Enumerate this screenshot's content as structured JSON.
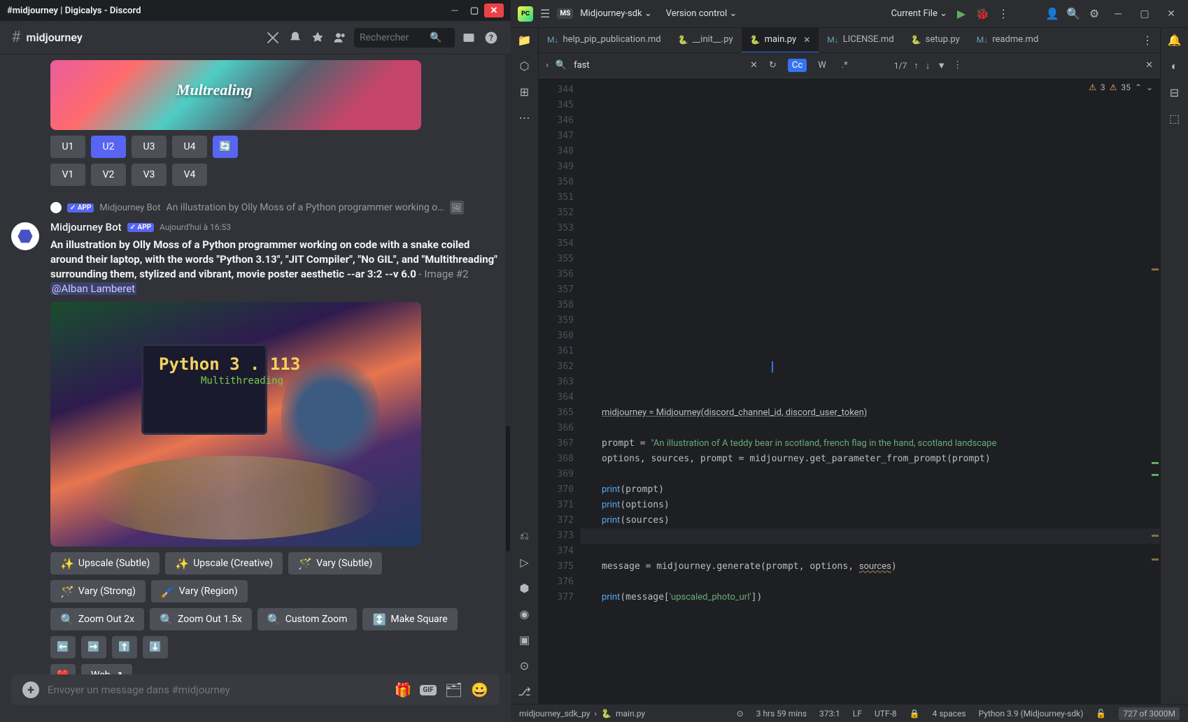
{
  "discord": {
    "window_title": "#midjourney | Digicalys - Discord",
    "channel_name": "midjourney",
    "search_placeholder": "Rechercher",
    "thumb_overlay_text": "Multrealing",
    "u_buttons": [
      "U1",
      "U2",
      "U3",
      "U4"
    ],
    "v_buttons": [
      "V1",
      "V2",
      "V3",
      "V4"
    ],
    "reply_channel": "#midjourney",
    "reply_bot": "Midjourney Bot",
    "reply_tag": "✓ APP",
    "reply_preview": "An illustration by Olly Moss of a Python programmer working o…",
    "bot_name": "Midjourney Bot",
    "bot_tag": "✓ APP",
    "timestamp": "Aujourd'hui à 16:53",
    "prompt_bold": "An illustration by Olly Moss of a Python programmer working on code with a snake coiled around their laptop, with the words \"Python 3.13\", \"JIT Compiler\", \"No GIL\", and \"Multithreading\" surrounding them, stylized and vibrant, movie poster aesthetic --ar 3:2 --v 6.0",
    "image_num": " - Image #2 ",
    "mention": "@Alban Lamberet",
    "gen_img_text1": "Python  3 . 113",
    "gen_img_text2": "Multithreading",
    "action_row1": [
      {
        "icon": "✨",
        "label": "Upscale (Subtle)"
      },
      {
        "icon": "✨",
        "label": "Upscale (Creative)"
      },
      {
        "icon": "🪄",
        "label": "Vary (Subtle)"
      }
    ],
    "action_row2": [
      {
        "icon": "🪄",
        "label": "Vary (Strong)"
      },
      {
        "icon": "🖌️",
        "label": "Vary (Region)"
      }
    ],
    "action_row3": [
      {
        "icon": "🔍",
        "label": "Zoom Out 2x"
      },
      {
        "icon": "🔍",
        "label": "Zoom Out 1.5x"
      },
      {
        "icon": "🔍",
        "label": "Custom Zoom"
      },
      {
        "icon": "↕️",
        "label": "Make Square"
      }
    ],
    "arrow_row": [
      "⬅️",
      "➡️",
      "⬆️",
      "⬇️"
    ],
    "extra_row": [
      {
        "icon": "❤️",
        "label": ""
      },
      {
        "icon": "",
        "label": "Web",
        "trail": "↗"
      }
    ],
    "input_placeholder": "Envoyer un message dans #midjourney",
    "gif_label": "GIF"
  },
  "ide": {
    "project_badge": "MS",
    "project_name": "Midjourney-sdk",
    "version_control": "Version control",
    "run_config": "Current File",
    "tabs": [
      {
        "icon": "M↓",
        "label": "help_pip_publication.md",
        "type": "md"
      },
      {
        "icon": "py",
        "label": "__init__.py",
        "type": "py"
      },
      {
        "icon": "py",
        "label": "main.py",
        "type": "py",
        "active": true,
        "closable": true
      },
      {
        "icon": "M↓",
        "label": "LICENSE.md",
        "type": "md"
      },
      {
        "icon": "py",
        "label": "setup.py",
        "type": "py"
      },
      {
        "icon": "M↓",
        "label": "readme.md",
        "type": "md"
      }
    ],
    "search_value": "fast",
    "search_count": "1/7",
    "warn1": "3",
    "warn2": "35",
    "line_start": 344,
    "line_end": 377,
    "code_lines": {
      "365": {
        "raw": "midjourney = Midjourney(discord_channel_id, discord_user_token)"
      },
      "367": {
        "raw": "prompt = \"An illustration of A teddy bear in scotland, french flag in the hand, scotland landscape"
      },
      "368": {
        "raw": "options, sources, prompt = midjourney.get_parameter_from_prompt(prompt)"
      },
      "370": {
        "raw": "print(prompt)"
      },
      "371": {
        "raw": "print(options)"
      },
      "372": {
        "raw": "print(sources)"
      },
      "374": {
        "raw": "message = midjourney.generate(prompt, options, sources)"
      },
      "376": {
        "raw": "print(message['upscaled_photo_url'])"
      }
    },
    "status": {
      "crumb1": "midjourney_sdk_py",
      "crumb2": "main.py",
      "uptime": "3 hrs 59 mins",
      "pos": "373:1",
      "line_sep": "LF",
      "encoding": "UTF-8",
      "indent": "4 spaces",
      "interpreter": "Python 3.9 (Midjourney-sdk)",
      "trial": "727 of 3000M"
    }
  }
}
